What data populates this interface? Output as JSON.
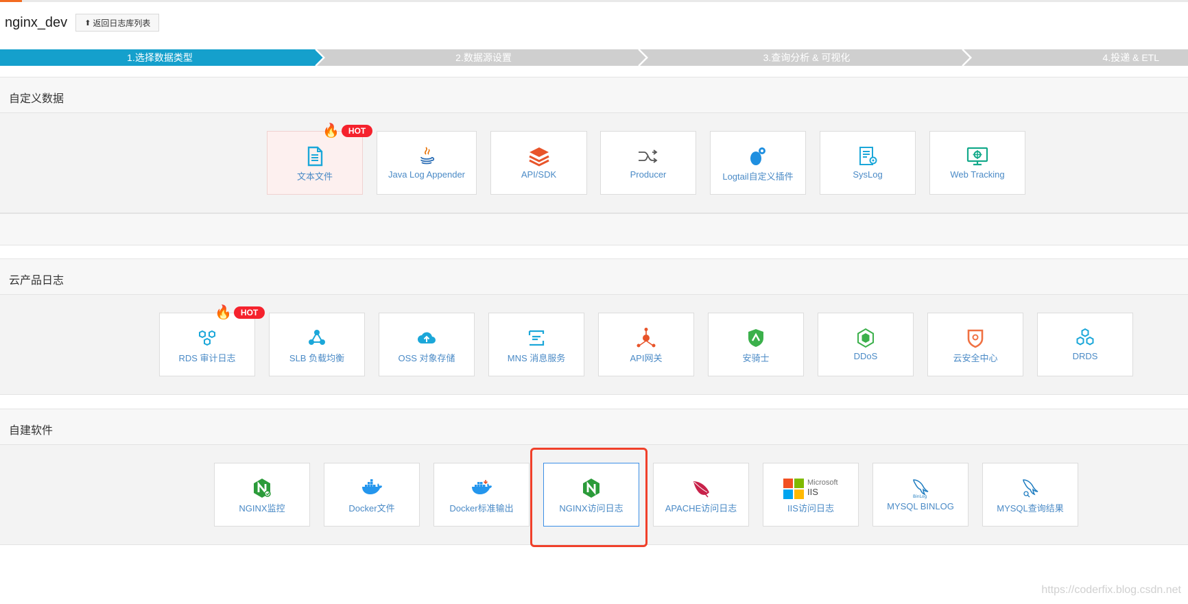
{
  "header": {
    "title": "nginx_dev",
    "back_label": "返回日志库列表"
  },
  "steps": [
    {
      "label": "1.选择数据类型",
      "active": true
    },
    {
      "label": "2.数据源设置",
      "active": false
    },
    {
      "label": "3.查询分析 & 可视化",
      "active": false
    },
    {
      "label": "4.投递 & ETL",
      "active": false
    }
  ],
  "hot_label": "HOT",
  "sections": {
    "custom": {
      "title": "自定义数据",
      "items": [
        {
          "label": "文本文件",
          "icon": "text-file-icon"
        },
        {
          "label": "Java Log Appender",
          "icon": "java-icon"
        },
        {
          "label": "API/SDK",
          "icon": "layers-icon"
        },
        {
          "label": "Producer",
          "icon": "producer-arrow-icon"
        },
        {
          "label": "Logtail自定义插件",
          "icon": "plugin-icon"
        },
        {
          "label": "SysLog",
          "icon": "syslog-icon"
        },
        {
          "label": "Web Tracking",
          "icon": "monitor-icon"
        }
      ]
    },
    "cloud": {
      "title": "云产品日志",
      "items": [
        {
          "label": "RDS 审计日志",
          "icon": "rds-icon"
        },
        {
          "label": "SLB 负载均衡",
          "icon": "slb-icon"
        },
        {
          "label": "OSS 对象存储",
          "icon": "oss-icon"
        },
        {
          "label": "MNS 消息服务",
          "icon": "mns-icon"
        },
        {
          "label": "API网关",
          "icon": "api-gateway-icon"
        },
        {
          "label": "安骑士",
          "icon": "shield-icon"
        },
        {
          "label": "DDoS",
          "icon": "ddos-icon"
        },
        {
          "label": "云安全中心",
          "icon": "security-center-icon"
        },
        {
          "label": "DRDS",
          "icon": "drds-icon"
        }
      ]
    },
    "selfbuilt": {
      "title": "自建软件",
      "items": [
        {
          "label": "NGINX监控",
          "icon": "nginx-icon"
        },
        {
          "label": "Docker文件",
          "icon": "docker-icon"
        },
        {
          "label": "Docker标准输出",
          "icon": "docker-icon"
        },
        {
          "label": "NGINX访问日志",
          "icon": "nginx-icon"
        },
        {
          "label": "APACHE访问日志",
          "icon": "apache-feather-icon"
        },
        {
          "label": "IIS访问日志",
          "icon": "microsoft-iis-icon"
        },
        {
          "label": "MYSQL BINLOG",
          "icon": "mysql-dolphin-icon"
        },
        {
          "label": "MYSQL查询结果",
          "icon": "mysql-dolphin-icon"
        }
      ]
    }
  },
  "iis_logo": {
    "brand": "Microsoft",
    "product": "IIS"
  },
  "mysql_binlog_tag": "BinLog",
  "watermark": "https://coderfix.blog.csdn.net",
  "colors": {
    "accent": "#15a0cc",
    "step_inactive": "#cfcfcf",
    "link": "#4a8ac6",
    "hot": "#f5222d",
    "highlight": "#f0402a"
  }
}
